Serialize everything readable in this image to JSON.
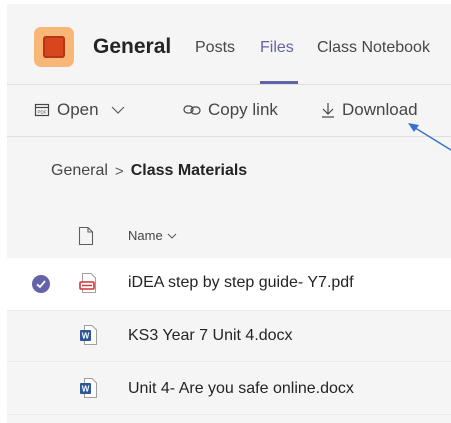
{
  "header": {
    "title": "General",
    "tabs": [
      {
        "label": "Posts",
        "active": false
      },
      {
        "label": "Files",
        "active": true
      },
      {
        "label": "Class Notebook",
        "active": false
      }
    ]
  },
  "toolbar": {
    "open_label": "Open",
    "copy_link_label": "Copy link",
    "download_label": "Download"
  },
  "breadcrumb": {
    "root": "General",
    "current": "Class Materials"
  },
  "table": {
    "name_header": "Name",
    "rows": [
      {
        "name": "iDEA step by step guide- Y7.pdf",
        "type": "pdf",
        "selected": true
      },
      {
        "name": "KS3 Year 7 Unit 4.docx",
        "type": "docx",
        "selected": false
      },
      {
        "name": "Unit 4- Are you safe online.docx",
        "type": "docx",
        "selected": false
      }
    ]
  },
  "colors": {
    "accent": "#6264a7",
    "annotation_arrow": "#3a6fd0",
    "word_blue": "#2b579a",
    "pdf_red": "#d13438"
  },
  "icons": [
    "app-icon",
    "open-icon",
    "chevron-down-icon",
    "link-icon",
    "download-icon",
    "file-icon",
    "checkmark-icon",
    "pdf-file-icon",
    "word-file-icon"
  ]
}
